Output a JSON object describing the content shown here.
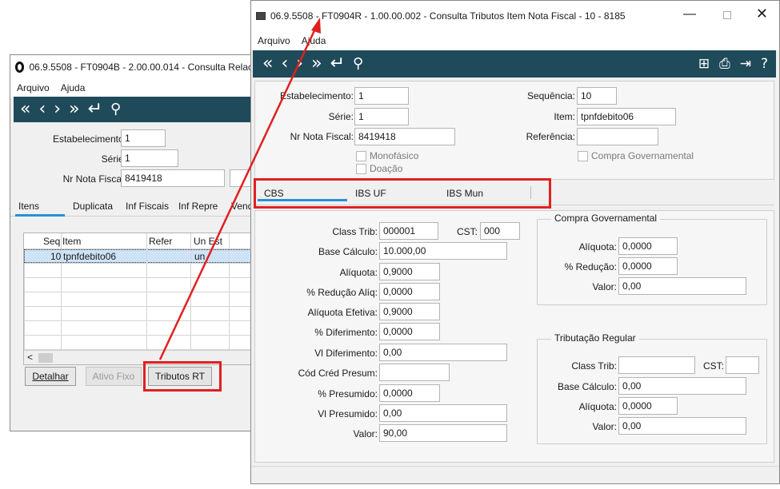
{
  "back_window": {
    "title": "06.9.5508 - FT0904B - 2.00.00.014 - Consulta Relac",
    "menu": [
      "Arquivo",
      "Ajuda"
    ],
    "fields": {
      "estab_label": "Estabelecimento:",
      "estab_value": "1",
      "serie_label": "Série:",
      "serie_value": "1",
      "nf_label": "Nr Nota Fiscal:",
      "nf_value": "8419418"
    },
    "tabs": [
      "Itens",
      "Duplicata",
      "Inf Fiscais",
      "Inf Repre",
      "Vend"
    ],
    "table": {
      "headers": [
        "Seq",
        "Item",
        "Refer",
        "Un Est"
      ],
      "rows": [
        [
          "10",
          "tpnfdebito06",
          "",
          "un"
        ]
      ]
    },
    "buttons": {
      "detalhar": "Detalhar",
      "ativo_fixo": "Ativo Fixo",
      "tributos_rt": "Tributos RT"
    }
  },
  "front_window": {
    "title": "06.9.5508 - FT0904R - 1.00.00.002 - Consulta Tributos Item Nota Fiscal - 10 - 8185",
    "menu": [
      "Arquivo",
      "Ajuda"
    ],
    "header": {
      "estab_label": "Estabelecimento:",
      "estab_value": "1",
      "serie_label": "Série:",
      "serie_value": "1",
      "nf_label": "Nr Nota Fiscal:",
      "nf_value": "8419418",
      "monofasico": "Monofásico",
      "doacao": "Doação",
      "seq_label": "Sequência:",
      "seq_value": "10",
      "item_label": "Item:",
      "item_value": "tpnfdebito06",
      "ref_label": "Referência:",
      "ref_value": "",
      "compra_gov": "Compra Governamental"
    },
    "tabs": [
      "CBS",
      "IBS UF",
      "IBS Mun"
    ],
    "cbs": {
      "class_trib_label": "Class Trib:",
      "class_trib": "000001",
      "cst_label": "CST:",
      "cst": "000",
      "base_label": "Base Cálculo:",
      "base": "10.000,00",
      "aliq_label": "Alíquota:",
      "aliq": "0,9000",
      "red_aliq_label": "% Redução Alíq:",
      "red_aliq": "0,0000",
      "aliq_efet_label": "Alíquota Efetiva:",
      "aliq_efet": "0,9000",
      "dif_label": "% Diferimento:",
      "dif": "0,0000",
      "vl_dif_label": "Vl Diferimento:",
      "vl_dif": "0,00",
      "cred_label": "Cód Créd Presum:",
      "cred": "",
      "presum_label": "% Presumido:",
      "presum": "0,0000",
      "vl_presum_label": "Vl Presumido:",
      "vl_presum": "0,00",
      "valor_label": "Valor:",
      "valor": "90,00"
    },
    "compra_gov_group": {
      "title": "Compra Governamental",
      "aliq_label": "Alíquota:",
      "aliq": "0,0000",
      "red_label": "% Redução:",
      "red": "0,0000",
      "valor_label": "Valor:",
      "valor": "0,00"
    },
    "trib_regular_group": {
      "title": "Tributação Regular",
      "class_trib_label": "Class Trib:",
      "class_trib": "",
      "cst_label": "CST:",
      "cst": "",
      "base_label": "Base Cálculo:",
      "base": "0,00",
      "aliq_label": "Alíquota:",
      "aliq": "0,0000",
      "valor_label": "Valor:",
      "valor": "0,00"
    }
  },
  "colors": {
    "toolbar": "#1f4a5a",
    "highlight_red": "#e02020",
    "tab_underline": "#2a8fd8",
    "selected_row": "#cfe3f7"
  }
}
